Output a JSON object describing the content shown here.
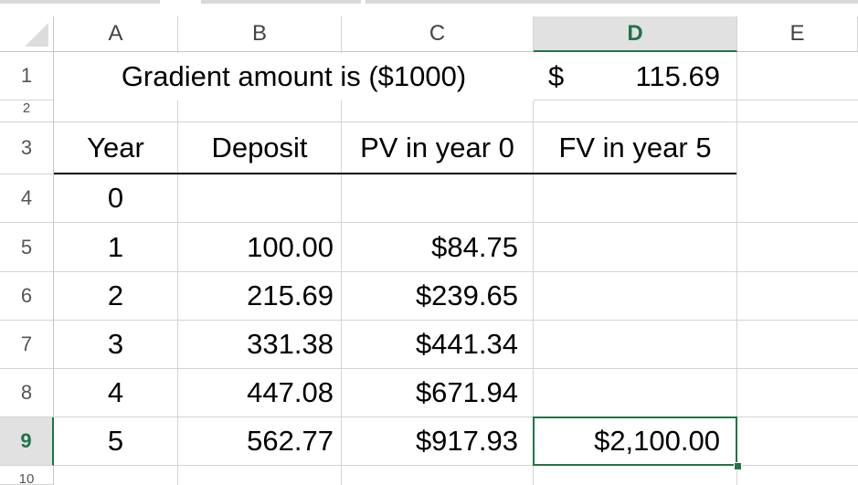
{
  "columns": [
    "A",
    "B",
    "C",
    "D",
    "E"
  ],
  "rows": [
    "1",
    "2",
    "3",
    "4",
    "5",
    "6",
    "7",
    "8",
    "9",
    "10"
  ],
  "selected": {
    "column": "D",
    "row": "9"
  },
  "cells": {
    "A1": "Gradient amount is ($1000)",
    "D1_symbol": "$",
    "D1_value": "115.69",
    "A3": "Year",
    "B3": "Deposit",
    "C3": "PV in year 0",
    "D3": "FV in year 5",
    "A4": "0",
    "A5": "1",
    "B5": "100.00",
    "C5": "$84.75",
    "A6": "2",
    "B6": "215.69",
    "C6": "$239.65",
    "A7": "3",
    "B7": "331.38",
    "C7": "$441.34",
    "A8": "4",
    "B8": "447.08",
    "C8": "$671.94",
    "A9": "5",
    "B9": "562.77",
    "C9": "$917.93",
    "D9": "$2,100.00"
  },
  "colors": {
    "selection": "#217346",
    "header_selected_bg": "#e1e1e1",
    "gridline": "#d4d4d4"
  }
}
